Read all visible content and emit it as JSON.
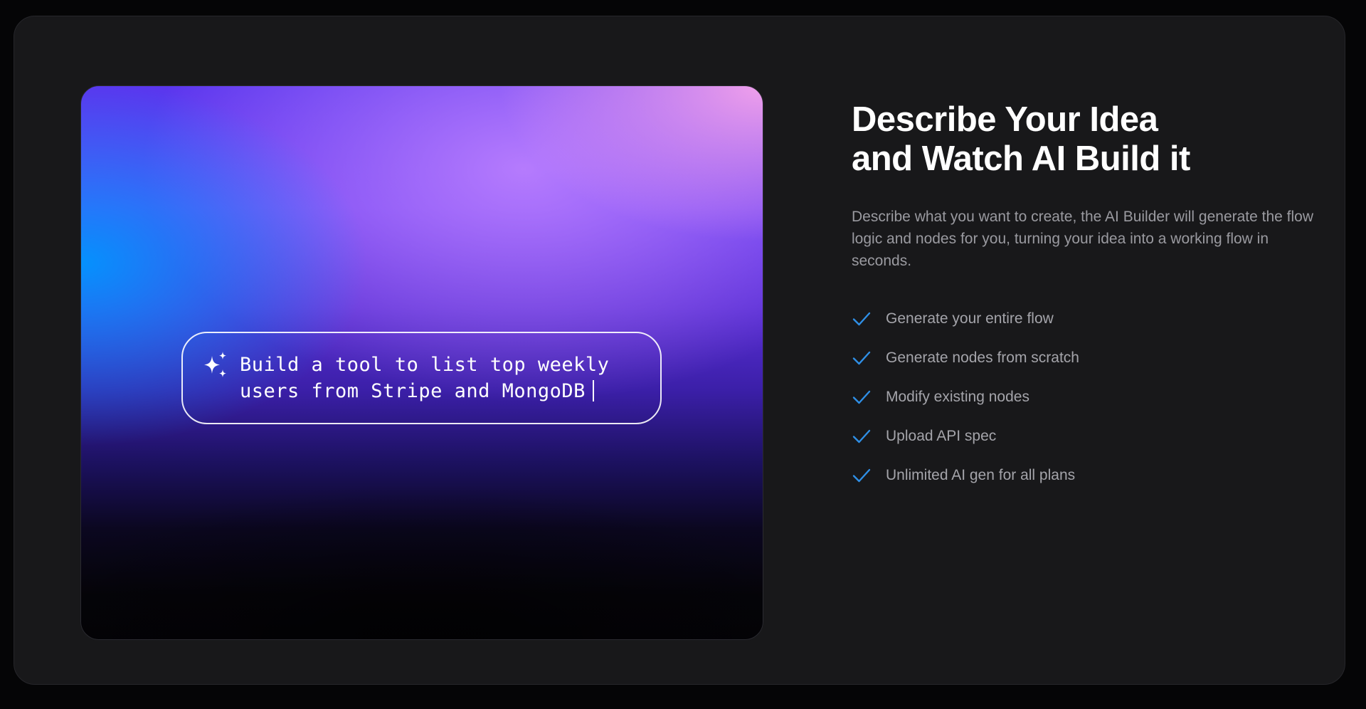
{
  "hero": {
    "prompt_lines": [
      "Build a tool to list top weekly",
      "users from Stripe and MongoDB"
    ],
    "icon": "sparkle-icon"
  },
  "content": {
    "title_lines": [
      "Describe Your Idea",
      "and Watch AI Build it"
    ],
    "description": "Describe what you want to create, the AI Builder will generate the flow logic and nodes for you, turning your idea into a working flow in seconds.",
    "features": [
      "Generate your entire flow",
      "Generate nodes from scratch",
      "Modify existing nodes",
      "Upload API spec",
      "Unlimited AI gen for all plans"
    ],
    "feature_icon": "check-icon"
  },
  "colors": {
    "background": "#050506",
    "card": "#18181a",
    "check": "#2f8fe6",
    "text_muted": "#9a9aa0"
  }
}
